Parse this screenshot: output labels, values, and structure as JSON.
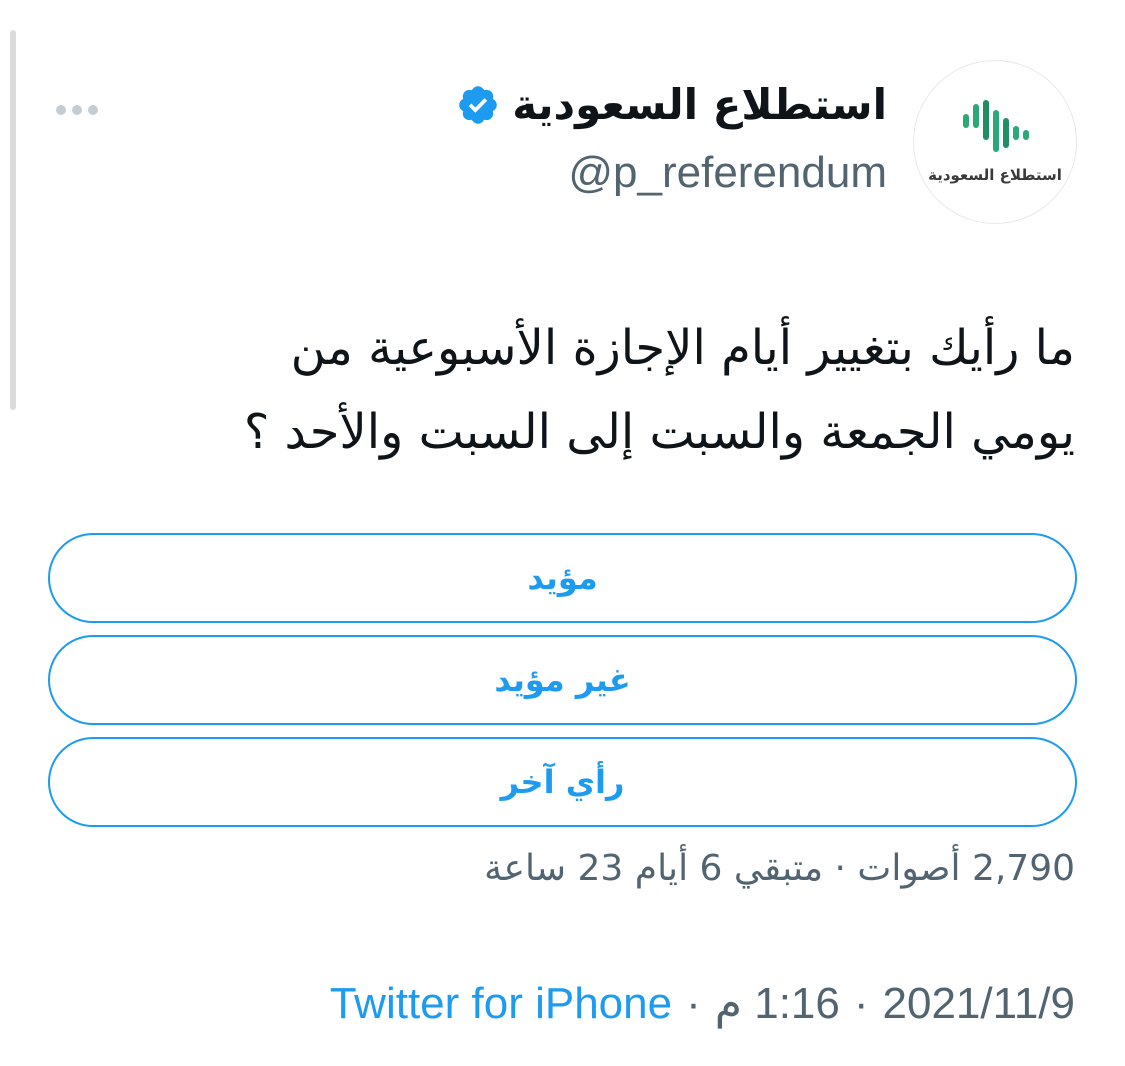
{
  "tweet": {
    "display_name": "استطلاع السعودية",
    "handle": "@p_referendum",
    "avatar_label": "استطلاع السعودية",
    "text_line1": "ما رأيك بتغيير أيام الإجازة الأسبوعية من",
    "text_line2": "يومي الجمعة والسبت إلى السبت والأحد ؟",
    "more_icon": "more-horizontal-icon",
    "verified_icon": "verified-badge-icon"
  },
  "poll": {
    "options": [
      {
        "label": "مؤيد"
      },
      {
        "label": "غير مؤيد"
      },
      {
        "label": "رأي آخر"
      }
    ],
    "meta": "2,790 أصوات · متبقي 6 أيام 23 ساعة"
  },
  "footer": {
    "date": "2021/11/9",
    "separator": "·",
    "time": "1:16 م",
    "source": "Twitter for iPhone"
  },
  "colors": {
    "accent": "#1d9bf0",
    "secondary_text": "#536471",
    "primary_text": "#0f1419",
    "avatar_green": "#2aa876"
  }
}
